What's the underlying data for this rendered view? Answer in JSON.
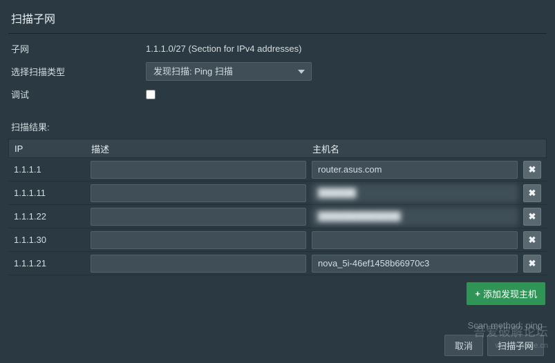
{
  "dialog": {
    "title": "扫描子网"
  },
  "form": {
    "subnet_label": "子网",
    "subnet_value": "1.1.1.0/27 (Section for IPv4 addresses)",
    "scan_type_label": "选择扫描类型",
    "scan_type_selected": "发现扫描: Ping 扫描",
    "debug_label": "调试"
  },
  "results": {
    "heading": "扫描结果:",
    "columns": {
      "ip": "IP",
      "desc": "描述",
      "host": "主机名"
    },
    "rows": [
      {
        "ip": "1.1.1.1",
        "desc": "",
        "host": "router.asus.com",
        "host_blurred": false
      },
      {
        "ip": "1.1.1.11",
        "desc": "",
        "host": "██████",
        "host_blurred": true
      },
      {
        "ip": "1.1.1.22",
        "desc": "",
        "host": "█████████████",
        "host_blurred": true
      },
      {
        "ip": "1.1.1.30",
        "desc": "",
        "host": "",
        "host_blurred": false
      },
      {
        "ip": "1.1.1.21",
        "desc": "",
        "host": "nova_5i-46ef1458b66970c3",
        "host_blurred": false
      }
    ]
  },
  "actions": {
    "add_host": "添加发现主机",
    "scan_method": "Scan method: ping",
    "cancel": "取消",
    "scan_subnet": "扫描子网"
  },
  "watermark": {
    "line1": "吾爱破解论坛",
    "line2": "www.52pojie.cn"
  }
}
